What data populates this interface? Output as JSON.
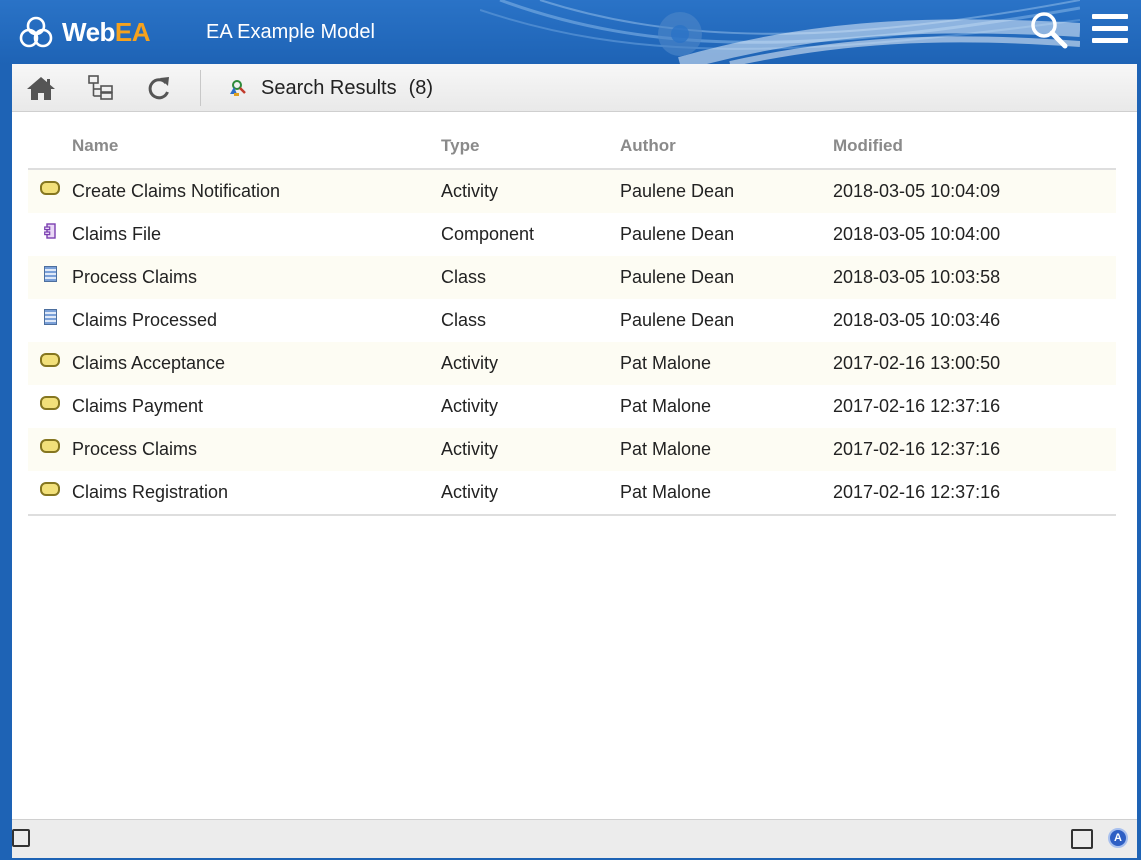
{
  "header": {
    "logo_prefix": "Web",
    "logo_accent": "EA",
    "model_title": "EA Example Model",
    "search_icon": "magnifier-icon",
    "menu_icon": "hamburger-menu-icon",
    "colors": {
      "bar": "#1e63b5",
      "logo_accent": "#f6a21e"
    }
  },
  "toolbar": {
    "home_icon": "home-icon",
    "tree_icon": "tree-browser-icon",
    "refresh_icon": "refresh-icon",
    "search_results_icon": "search-results-icon",
    "title": "Search Results",
    "count": "(8)"
  },
  "table": {
    "columns": {
      "name": "Name",
      "type": "Type",
      "author": "Author",
      "modified": "Modified"
    },
    "rows": [
      {
        "icon": "activity-icon",
        "name": "Create Claims Notification",
        "type": "Activity",
        "author": "Paulene Dean",
        "modified": "2018-03-05 10:04:09"
      },
      {
        "icon": "component-icon",
        "name": "Claims File",
        "type": "Component",
        "author": "Paulene Dean",
        "modified": "2018-03-05 10:04:00"
      },
      {
        "icon": "class-icon",
        "name": "Process Claims",
        "type": "Class",
        "author": "Paulene Dean",
        "modified": "2018-03-05 10:03:58"
      },
      {
        "icon": "class-icon",
        "name": "Claims Processed",
        "type": "Class",
        "author": "Paulene Dean",
        "modified": "2018-03-05 10:03:46"
      },
      {
        "icon": "activity-icon",
        "name": "Claims Acceptance",
        "type": "Activity",
        "author": "Pat Malone",
        "modified": "2017-02-16 13:00:50"
      },
      {
        "icon": "activity-icon",
        "name": "Claims Payment",
        "type": "Activity",
        "author": "Pat Malone",
        "modified": "2017-02-16 12:37:16"
      },
      {
        "icon": "activity-icon",
        "name": "Process Claims",
        "type": "Activity",
        "author": "Pat Malone",
        "modified": "2017-02-16 12:37:16"
      },
      {
        "icon": "activity-icon",
        "name": "Claims Registration",
        "type": "Activity",
        "author": "Pat Malone",
        "modified": "2017-02-16 12:37:16"
      }
    ]
  },
  "footer": {
    "left_panel_icon": "panel-toggle-left-icon",
    "right_panel_icon": "panel-toggle-right-icon",
    "a_badge": "A"
  }
}
